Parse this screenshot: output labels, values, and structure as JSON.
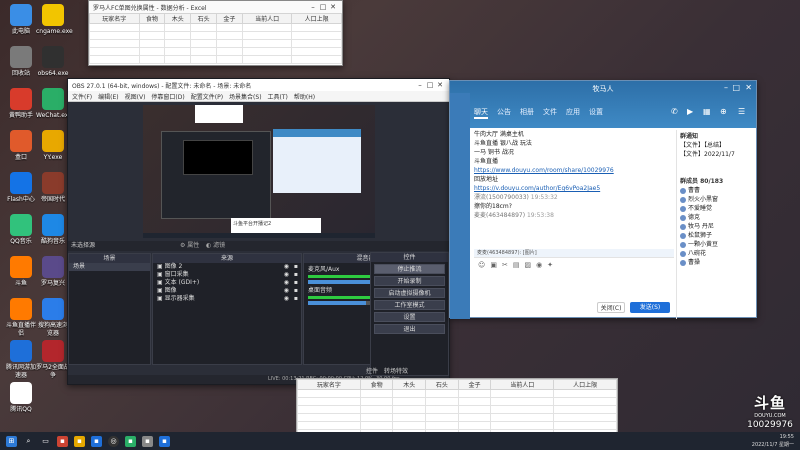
{
  "desktop_icons": [
    {
      "label": "此电脑",
      "icon": "computer-icon",
      "color": "#3a8ee6"
    },
    {
      "label": "cngame.exe",
      "icon": "pacman-icon",
      "color": "#f2c500"
    },
    {
      "label": "回收站",
      "icon": "recycle-bin-icon",
      "color": "#7a7a7a"
    },
    {
      "label": "obs64.exe",
      "icon": "obs-icon",
      "color": "#303030"
    },
    {
      "label": "黄鸭助手",
      "icon": "duck-icon",
      "color": "#d83b2b"
    },
    {
      "label": "WeChat.exe",
      "icon": "wechat-icon",
      "color": "#2aae67"
    },
    {
      "label": "盒口",
      "icon": "box-icon",
      "color": "#e05a2b"
    },
    {
      "label": "YY.exe",
      "icon": "yy-icon",
      "color": "#e8a800"
    },
    {
      "label": "Flash中心",
      "icon": "flash-icon",
      "color": "#1473e6"
    },
    {
      "label": "帝国时代",
      "icon": "game-icon",
      "color": "#8a3b2b"
    },
    {
      "label": "QQ音乐",
      "icon": "qqmusic-icon",
      "color": "#31c27c"
    },
    {
      "label": "酷狗音乐",
      "icon": "kugou-icon",
      "color": "#1e88e5"
    },
    {
      "label": "斗鱼",
      "icon": "douyu-icon",
      "color": "#ff7a00"
    },
    {
      "label": "罗马复兴",
      "icon": "rome-icon",
      "color": "#5a4a8a"
    },
    {
      "label": "斗鱼直播伴侣",
      "icon": "douyu-live-icon",
      "color": "#ff7a00"
    },
    {
      "label": "搜狗高速浏览器",
      "icon": "sogou-icon",
      "color": "#2b7de9"
    },
    {
      "label": "腾讯网游加速器",
      "icon": "tencent-acc-icon",
      "color": "#1e6fd9"
    },
    {
      "label": "罗马2全面战争",
      "icon": "rome2-icon",
      "color": "#b3262c"
    },
    {
      "label": "腾讯QQ",
      "icon": "qq-icon",
      "color": "#ffffff"
    }
  ],
  "top_sheet": {
    "title": "罗马人FC单图兑换属性 - 数据分析 - Excel",
    "columns": [
      "玩家名字",
      "食物",
      "木头",
      "石头",
      "金子",
      "当前人口",
      "人口上限"
    ]
  },
  "obs": {
    "title": "OBS 27.0.1 (64-bit, windows) - 配置文件: 未命名 - 场景: 未命名",
    "menu": [
      "文件(F)",
      "编辑(E)",
      "视图(V)",
      "停靠窗口(D)",
      "配置文件(P)",
      "场景集合(S)",
      "工具(T)",
      "帮助(H)"
    ],
    "scene_label": "未选择源",
    "dock_headers": {
      "scenes": "场景",
      "sources": "来源",
      "mixer": "混音器",
      "controls": "控件"
    },
    "scenes": [
      "场景"
    ],
    "sources": [
      "图像 2",
      "窗口采集",
      "文本 (GDI+)",
      "图像",
      "显示器采集"
    ],
    "mixer": [
      {
        "name": "麦克风/Aux",
        "db": "0.0 dB",
        "level": 0.72
      },
      {
        "name": "桌面音频",
        "db": "0.0 dB",
        "level": 0.6
      }
    ],
    "controls": [
      "停止推流",
      "开始录制",
      "启动虚拟摄像机",
      "工作室模式",
      "设置",
      "退出"
    ],
    "bottom_tabs": [
      "控件",
      "转场特效"
    ],
    "status": "LIVE: 00:13:21   REC: 00:00:00   CPU: 12.0%, 30.00 fps",
    "preview_caption": "斗鱼平台开播记2"
  },
  "qq": {
    "title": "牧马人",
    "tabs": [
      "聊天",
      "公告",
      "相册",
      "文件",
      "应用",
      "设置"
    ],
    "messages": [
      {
        "kind": "text",
        "text": "牛肉大厅 满桌主机"
      },
      {
        "kind": "text",
        "text": "斗鱼直播 银八战  玩法"
      },
      {
        "kind": "text",
        "text": "一马  铜书  战况"
      },
      {
        "kind": "text",
        "text": "斗鱼直播"
      },
      {
        "kind": "link",
        "text": "https://www.douyu.com/room/share/10029976"
      },
      {
        "kind": "text",
        "text": "回放地址"
      },
      {
        "kind": "link",
        "text": "https://v.douyu.com/author/Eg6vPoa2Jae5"
      },
      {
        "kind": "meta",
        "nick": "漂流(1500790033)",
        "time": "19:53:32"
      },
      {
        "kind": "text",
        "text": "擦你的18cm?"
      },
      {
        "kind": "meta",
        "nick": "麦麦(463484897)",
        "time": "19:53:38"
      }
    ],
    "reply_preview": "麦麦(463484897): [图片]",
    "notice_title": "群通知",
    "files": [
      "【文件】【总结】",
      "【文件】2022/11/7"
    ],
    "member_title": "群成员 80/183",
    "members": [
      "曹曹",
      "烈火小黑窗",
      "不爱睡觉",
      "德克",
      "牧马 丹尼",
      "松鼠狮子",
      "一颗小黄豆",
      "八碗花",
      "曹操"
    ],
    "close_btn": "关闭(C)",
    "send_btn": "发送(S)"
  },
  "bottom_sheet": {
    "columns": [
      "玩家名字",
      "食物",
      "木头",
      "石头",
      "金子",
      "当前人口",
      "人口上限"
    ]
  },
  "douyu": {
    "logo": "斗鱼",
    "site": "DOUYU.COM",
    "room": "10029976"
  },
  "tray": {
    "time": "19:55",
    "date": "2022/11/7 星期一"
  }
}
